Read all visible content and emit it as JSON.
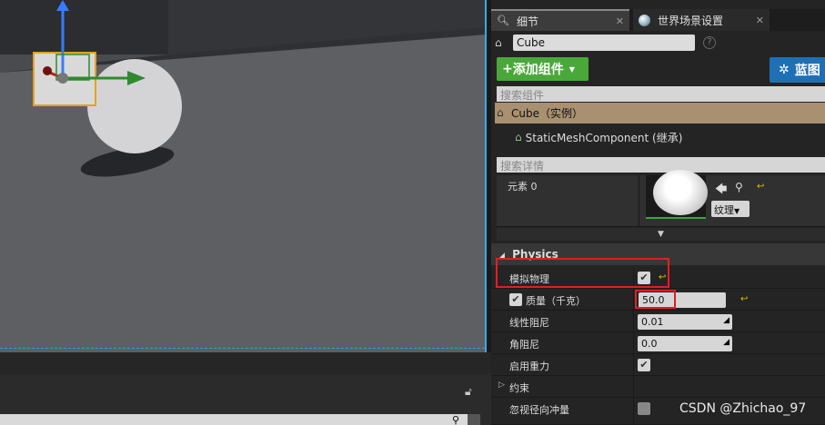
{
  "tabs": {
    "details": "细节",
    "world": "世界场景设置"
  },
  "actor_name": "Cube",
  "add_component": "添加组件",
  "blueprint": "蓝图",
  "search_components_placeholder": "搜索组件",
  "tree": {
    "instance": "Cube（实例）",
    "child": "StaticMeshComponent (继承)"
  },
  "search_details_placeholder": "搜索详情",
  "element0": {
    "label": "元素 0",
    "texture_dropdown": "纹理"
  },
  "physics": {
    "title": "Physics",
    "simulate": "模拟物理",
    "mass_label": "质量（千克）",
    "mass_value": "50.0",
    "linear_damping_label": "线性阻尼",
    "linear_damping": "0.01",
    "angular_damping_label": "角阻尼",
    "angular_damping": "0.0",
    "gravity_label": "启用重力",
    "constraints": "约束",
    "ignore_radial": "忽视径向冲量"
  },
  "watermark": "CSDN @Zhichao_97"
}
